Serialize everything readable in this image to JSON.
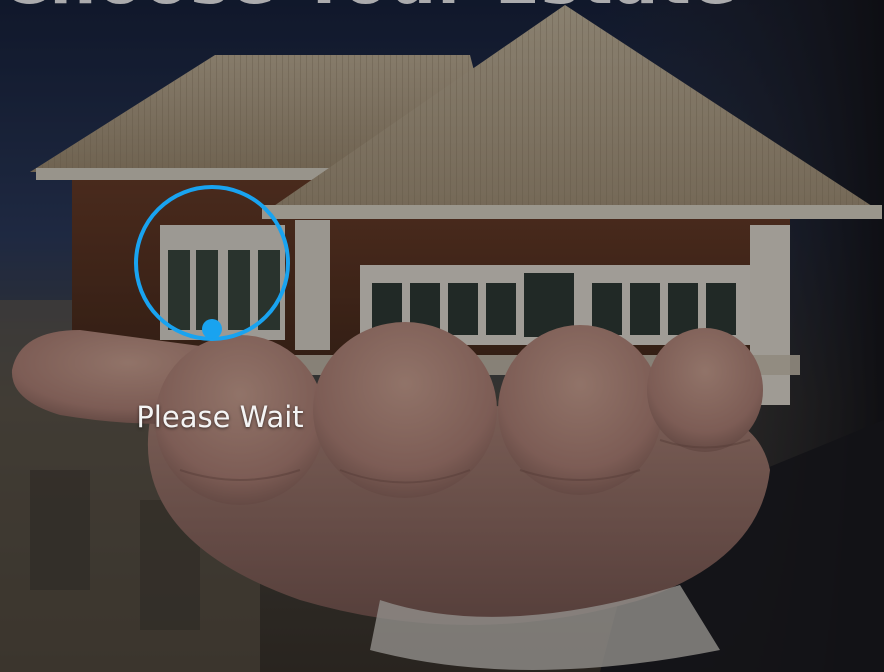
{
  "hero": {
    "heading": "Choose Your Estate"
  },
  "loader": {
    "message": "Please Wait",
    "ring_color": "#19a3f0"
  },
  "colors": {
    "overlay": "#0a0c10",
    "sky_top": "#1d2a4a",
    "roof": "#b5a486",
    "wall_wood": "#5a3320",
    "hand": "#c89a86"
  }
}
